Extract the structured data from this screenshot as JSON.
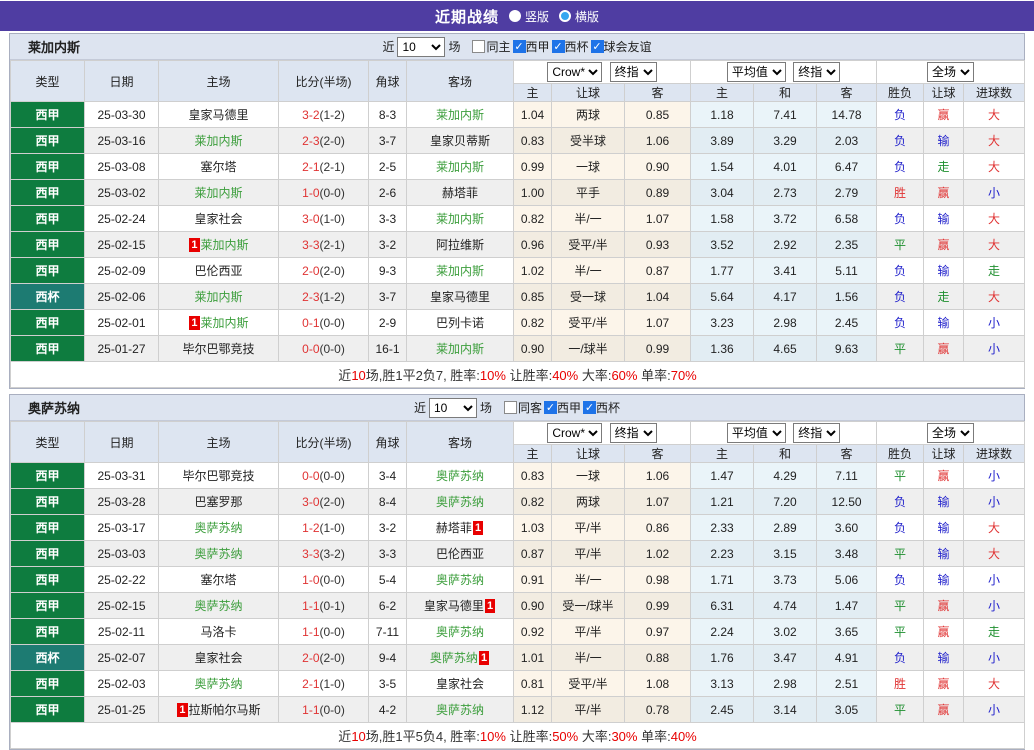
{
  "title_bar": {
    "title": "近期战绩",
    "vertical_label": "竖版",
    "horizontal_label": "横版"
  },
  "selects": {
    "company": "Crow*",
    "final": "终指",
    "average": "平均值",
    "final2": "终指",
    "scope": "全场"
  },
  "columns_left": [
    "类型",
    "日期",
    "主场",
    "比分(半场)",
    "角球",
    "客场"
  ],
  "columns_right": [
    "主",
    "让球",
    "客",
    "主",
    "和",
    "客",
    "胜负",
    "让球",
    "进球数"
  ],
  "colors": {
    "header_bar": "#4f3da2",
    "section_head_bg": "#dde4f0",
    "header_cell_bg": "#dde5f1",
    "liga_green": "#0e7c3f",
    "cup_teal": "#1d7b72",
    "team_green": "#3c9e3c",
    "score_red": "#e03333",
    "result_red": "#e03333",
    "result_blue": "#2222cc",
    "result_green": "#1f8f2f",
    "odds_col_bg": "#fcf5ea",
    "avg_col_bg": "#eaf4f9",
    "alt_row_bg": "#efefef",
    "summary_red": "#e80000",
    "red_card_badge": "#e80000",
    "checkbox_blue": "#1e73e8"
  },
  "sections": [
    {
      "team": "莱加内斯",
      "filter": {
        "recent_label": "近",
        "count": "10",
        "matches_label": "场",
        "checkboxes": [
          {
            "label": "同主",
            "checked": false
          },
          {
            "label": "西甲",
            "checked": true
          },
          {
            "label": "西杯",
            "checked": true
          },
          {
            "label": "球会友谊",
            "checked": true
          }
        ]
      },
      "rows": [
        {
          "league": "西甲",
          "cls": "liga",
          "date": "25-03-30",
          "home": {
            "name": "皇家马德里",
            "green": false,
            "badge": ""
          },
          "score": "3-2",
          "half": "(1-2)",
          "corner": "8-3",
          "away": {
            "name": "莱加内斯",
            "green": true,
            "badge": ""
          },
          "odds": [
            "1.04",
            "两球",
            "0.85"
          ],
          "avg": [
            "1.18",
            "7.41",
            "14.78"
          ],
          "res": [
            [
              "负",
              "blue"
            ],
            [
              "赢",
              "red"
            ],
            [
              "大",
              "red"
            ]
          ]
        },
        {
          "league": "西甲",
          "cls": "liga",
          "date": "25-03-16",
          "home": {
            "name": "莱加内斯",
            "green": true,
            "badge": ""
          },
          "score": "2-3",
          "half": "(2-0)",
          "corner": "3-7",
          "away": {
            "name": "皇家贝蒂斯",
            "green": false,
            "badge": ""
          },
          "odds": [
            "0.83",
            "受半球",
            "1.06"
          ],
          "avg": [
            "3.89",
            "3.29",
            "2.03"
          ],
          "res": [
            [
              "负",
              "blue"
            ],
            [
              "输",
              "blue"
            ],
            [
              "大",
              "red"
            ]
          ]
        },
        {
          "league": "西甲",
          "cls": "liga",
          "date": "25-03-08",
          "home": {
            "name": "塞尔塔",
            "green": false,
            "badge": ""
          },
          "score": "2-1",
          "half": "(2-1)",
          "corner": "2-5",
          "away": {
            "name": "莱加内斯",
            "green": true,
            "badge": ""
          },
          "odds": [
            "0.99",
            "一球",
            "0.90"
          ],
          "avg": [
            "1.54",
            "4.01",
            "6.47"
          ],
          "res": [
            [
              "负",
              "blue"
            ],
            [
              "走",
              "green"
            ],
            [
              "大",
              "red"
            ]
          ]
        },
        {
          "league": "西甲",
          "cls": "liga",
          "date": "25-03-02",
          "home": {
            "name": "莱加内斯",
            "green": true,
            "badge": ""
          },
          "score": "1-0",
          "half": "(0-0)",
          "corner": "2-6",
          "away": {
            "name": "赫塔菲",
            "green": false,
            "badge": ""
          },
          "odds": [
            "1.00",
            "平手",
            "0.89"
          ],
          "avg": [
            "3.04",
            "2.73",
            "2.79"
          ],
          "res": [
            [
              "胜",
              "red"
            ],
            [
              "赢",
              "red"
            ],
            [
              "小",
              "blue"
            ]
          ]
        },
        {
          "league": "西甲",
          "cls": "liga",
          "date": "25-02-24",
          "home": {
            "name": "皇家社会",
            "green": false,
            "badge": ""
          },
          "score": "3-0",
          "half": "(1-0)",
          "corner": "3-3",
          "away": {
            "name": "莱加内斯",
            "green": true,
            "badge": ""
          },
          "odds": [
            "0.82",
            "半/一",
            "1.07"
          ],
          "avg": [
            "1.58",
            "3.72",
            "6.58"
          ],
          "res": [
            [
              "负",
              "blue"
            ],
            [
              "输",
              "blue"
            ],
            [
              "大",
              "red"
            ]
          ]
        },
        {
          "league": "西甲",
          "cls": "liga",
          "date": "25-02-15",
          "home": {
            "name": "莱加内斯",
            "green": true,
            "badge": "1"
          },
          "score": "3-3",
          "half": "(2-1)",
          "corner": "3-2",
          "away": {
            "name": "阿拉维斯",
            "green": false,
            "badge": ""
          },
          "odds": [
            "0.96",
            "受平/半",
            "0.93"
          ],
          "avg": [
            "3.52",
            "2.92",
            "2.35"
          ],
          "res": [
            [
              "平",
              "green"
            ],
            [
              "赢",
              "red"
            ],
            [
              "大",
              "red"
            ]
          ]
        },
        {
          "league": "西甲",
          "cls": "liga",
          "date": "25-02-09",
          "home": {
            "name": "巴伦西亚",
            "green": false,
            "badge": ""
          },
          "score": "2-0",
          "half": "(2-0)",
          "corner": "9-3",
          "away": {
            "name": "莱加内斯",
            "green": true,
            "badge": ""
          },
          "odds": [
            "1.02",
            "半/一",
            "0.87"
          ],
          "avg": [
            "1.77",
            "3.41",
            "5.11"
          ],
          "res": [
            [
              "负",
              "blue"
            ],
            [
              "输",
              "blue"
            ],
            [
              "走",
              "green"
            ]
          ]
        },
        {
          "league": "西杯",
          "cls": "cup",
          "date": "25-02-06",
          "home": {
            "name": "莱加内斯",
            "green": true,
            "badge": ""
          },
          "score": "2-3",
          "half": "(1-2)",
          "corner": "3-7",
          "away": {
            "name": "皇家马德里",
            "green": false,
            "badge": ""
          },
          "odds": [
            "0.85",
            "受一球",
            "1.04"
          ],
          "avg": [
            "5.64",
            "4.17",
            "1.56"
          ],
          "res": [
            [
              "负",
              "blue"
            ],
            [
              "走",
              "green"
            ],
            [
              "大",
              "red"
            ]
          ]
        },
        {
          "league": "西甲",
          "cls": "liga",
          "date": "25-02-01",
          "home": {
            "name": "莱加内斯",
            "green": true,
            "badge": "1"
          },
          "score": "0-1",
          "half": "(0-0)",
          "corner": "2-9",
          "away": {
            "name": "巴列卡诺",
            "green": false,
            "badge": ""
          },
          "odds": [
            "0.82",
            "受平/半",
            "1.07"
          ],
          "avg": [
            "3.23",
            "2.98",
            "2.45"
          ],
          "res": [
            [
              "负",
              "blue"
            ],
            [
              "输",
              "blue"
            ],
            [
              "小",
              "blue"
            ]
          ]
        },
        {
          "league": "西甲",
          "cls": "liga",
          "date": "25-01-27",
          "home": {
            "name": "毕尔巴鄂竞技",
            "green": false,
            "badge": ""
          },
          "score": "0-0",
          "half": "(0-0)",
          "corner": "16-1",
          "away": {
            "name": "莱加内斯",
            "green": true,
            "badge": ""
          },
          "odds": [
            "0.90",
            "一/球半",
            "0.99"
          ],
          "avg": [
            "1.36",
            "4.65",
            "9.63"
          ],
          "res": [
            [
              "平",
              "green"
            ],
            [
              "赢",
              "red"
            ],
            [
              "小",
              "blue"
            ]
          ]
        }
      ],
      "summary": [
        [
          "近",
          false
        ],
        [
          "10",
          true
        ],
        [
          "场,胜1平2负7, 胜率:",
          false
        ],
        [
          "10%",
          true
        ],
        [
          " 让胜率:",
          false
        ],
        [
          "40%",
          true
        ],
        [
          " 大率:",
          false
        ],
        [
          "60%",
          true
        ],
        [
          " 单率:",
          false
        ],
        [
          "70%",
          true
        ]
      ]
    },
    {
      "team": "奥萨苏纳",
      "filter": {
        "recent_label": "近",
        "count": "10",
        "matches_label": "场",
        "checkboxes": [
          {
            "label": "同客",
            "checked": false
          },
          {
            "label": "西甲",
            "checked": true
          },
          {
            "label": "西杯",
            "checked": true
          }
        ]
      },
      "rows": [
        {
          "league": "西甲",
          "cls": "liga",
          "date": "25-03-31",
          "home": {
            "name": "毕尔巴鄂竞技",
            "green": false,
            "badge": ""
          },
          "score": "0-0",
          "half": "(0-0)",
          "corner": "3-4",
          "away": {
            "name": "奥萨苏纳",
            "green": true,
            "badge": ""
          },
          "odds": [
            "0.83",
            "一球",
            "1.06"
          ],
          "avg": [
            "1.47",
            "4.29",
            "7.11"
          ],
          "res": [
            [
              "平",
              "green"
            ],
            [
              "赢",
              "red"
            ],
            [
              "小",
              "blue"
            ]
          ]
        },
        {
          "league": "西甲",
          "cls": "liga",
          "date": "25-03-28",
          "home": {
            "name": "巴塞罗那",
            "green": false,
            "badge": ""
          },
          "score": "3-0",
          "half": "(2-0)",
          "corner": "8-4",
          "away": {
            "name": "奥萨苏纳",
            "green": true,
            "badge": ""
          },
          "odds": [
            "0.82",
            "两球",
            "1.07"
          ],
          "avg": [
            "1.21",
            "7.20",
            "12.50"
          ],
          "res": [
            [
              "负",
              "blue"
            ],
            [
              "输",
              "blue"
            ],
            [
              "小",
              "blue"
            ]
          ]
        },
        {
          "league": "西甲",
          "cls": "liga",
          "date": "25-03-17",
          "home": {
            "name": "奥萨苏纳",
            "green": true,
            "badge": ""
          },
          "score": "1-2",
          "half": "(1-0)",
          "corner": "3-2",
          "away": {
            "name": "赫塔菲",
            "green": false,
            "badge": "1"
          },
          "odds": [
            "1.03",
            "平/半",
            "0.86"
          ],
          "avg": [
            "2.33",
            "2.89",
            "3.60"
          ],
          "res": [
            [
              "负",
              "blue"
            ],
            [
              "输",
              "blue"
            ],
            [
              "大",
              "red"
            ]
          ]
        },
        {
          "league": "西甲",
          "cls": "liga",
          "date": "25-03-03",
          "home": {
            "name": "奥萨苏纳",
            "green": true,
            "badge": ""
          },
          "score": "3-3",
          "half": "(3-2)",
          "corner": "3-3",
          "away": {
            "name": "巴伦西亚",
            "green": false,
            "badge": ""
          },
          "odds": [
            "0.87",
            "平/半",
            "1.02"
          ],
          "avg": [
            "2.23",
            "3.15",
            "3.48"
          ],
          "res": [
            [
              "平",
              "green"
            ],
            [
              "输",
              "blue"
            ],
            [
              "大",
              "red"
            ]
          ]
        },
        {
          "league": "西甲",
          "cls": "liga",
          "date": "25-02-22",
          "home": {
            "name": "塞尔塔",
            "green": false,
            "badge": ""
          },
          "score": "1-0",
          "half": "(0-0)",
          "corner": "5-4",
          "away": {
            "name": "奥萨苏纳",
            "green": true,
            "badge": ""
          },
          "odds": [
            "0.91",
            "半/一",
            "0.98"
          ],
          "avg": [
            "1.71",
            "3.73",
            "5.06"
          ],
          "res": [
            [
              "负",
              "blue"
            ],
            [
              "输",
              "blue"
            ],
            [
              "小",
              "blue"
            ]
          ]
        },
        {
          "league": "西甲",
          "cls": "liga",
          "date": "25-02-15",
          "home": {
            "name": "奥萨苏纳",
            "green": true,
            "badge": ""
          },
          "score": "1-1",
          "half": "(0-1)",
          "corner": "6-2",
          "away": {
            "name": "皇家马德里",
            "green": false,
            "badge": "1"
          },
          "odds": [
            "0.90",
            "受一/球半",
            "0.99"
          ],
          "avg": [
            "6.31",
            "4.74",
            "1.47"
          ],
          "res": [
            [
              "平",
              "green"
            ],
            [
              "赢",
              "red"
            ],
            [
              "小",
              "blue"
            ]
          ]
        },
        {
          "league": "西甲",
          "cls": "liga",
          "date": "25-02-11",
          "home": {
            "name": "马洛卡",
            "green": false,
            "badge": ""
          },
          "score": "1-1",
          "half": "(0-0)",
          "corner": "7-11",
          "away": {
            "name": "奥萨苏纳",
            "green": true,
            "badge": ""
          },
          "odds": [
            "0.92",
            "平/半",
            "0.97"
          ],
          "avg": [
            "2.24",
            "3.02",
            "3.65"
          ],
          "res": [
            [
              "平",
              "green"
            ],
            [
              "赢",
              "red"
            ],
            [
              "走",
              "green"
            ]
          ]
        },
        {
          "league": "西杯",
          "cls": "cup",
          "date": "25-02-07",
          "home": {
            "name": "皇家社会",
            "green": false,
            "badge": ""
          },
          "score": "2-0",
          "half": "(2-0)",
          "corner": "9-4",
          "away": {
            "name": "奥萨苏纳",
            "green": true,
            "badge": "1"
          },
          "odds": [
            "1.01",
            "半/一",
            "0.88"
          ],
          "avg": [
            "1.76",
            "3.47",
            "4.91"
          ],
          "res": [
            [
              "负",
              "blue"
            ],
            [
              "输",
              "blue"
            ],
            [
              "小",
              "blue"
            ]
          ]
        },
        {
          "league": "西甲",
          "cls": "liga",
          "date": "25-02-03",
          "home": {
            "name": "奥萨苏纳",
            "green": true,
            "badge": ""
          },
          "score": "2-1",
          "half": "(1-0)",
          "corner": "3-5",
          "away": {
            "name": "皇家社会",
            "green": false,
            "badge": ""
          },
          "odds": [
            "0.81",
            "受平/半",
            "1.08"
          ],
          "avg": [
            "3.13",
            "2.98",
            "2.51"
          ],
          "res": [
            [
              "胜",
              "red"
            ],
            [
              "赢",
              "red"
            ],
            [
              "大",
              "red"
            ]
          ]
        },
        {
          "league": "西甲",
          "cls": "liga",
          "date": "25-01-25",
          "home": {
            "name": "拉斯帕尔马斯",
            "green": false,
            "badge": "1"
          },
          "score": "1-1",
          "half": "(0-0)",
          "corner": "4-2",
          "away": {
            "name": "奥萨苏纳",
            "green": true,
            "badge": ""
          },
          "odds": [
            "1.12",
            "平/半",
            "0.78"
          ],
          "avg": [
            "2.45",
            "3.14",
            "3.05"
          ],
          "res": [
            [
              "平",
              "green"
            ],
            [
              "赢",
              "red"
            ],
            [
              "小",
              "blue"
            ]
          ]
        }
      ],
      "summary": [
        [
          "近",
          false
        ],
        [
          "10",
          true
        ],
        [
          "场,胜1平5负4, 胜率:",
          false
        ],
        [
          "10%",
          true
        ],
        [
          " 让胜率:",
          false
        ],
        [
          "50%",
          true
        ],
        [
          " 大率:",
          false
        ],
        [
          "30%",
          true
        ],
        [
          " 单率:",
          false
        ],
        [
          "40%",
          true
        ]
      ]
    }
  ]
}
